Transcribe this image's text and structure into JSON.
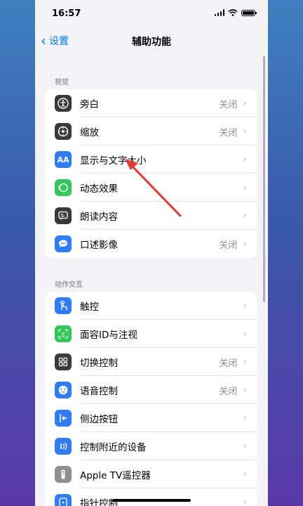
{
  "status": {
    "time": "16:57"
  },
  "navbar": {
    "back_label": "设置",
    "title": "辅助功能"
  },
  "sections": [
    {
      "label": "视觉",
      "items": [
        {
          "label": "旁白",
          "value": "关闭",
          "icon": "voiceover-icon",
          "color": "#3a3a3c"
        },
        {
          "label": "缩放",
          "value": "关闭",
          "icon": "zoom-icon",
          "color": "#3a3a3c"
        },
        {
          "label": "显示与文字大小",
          "value": "",
          "icon": "display-text-size-icon",
          "color": "#2f7cf6"
        },
        {
          "label": "动态效果",
          "value": "",
          "icon": "motion-icon",
          "color": "#34c759"
        },
        {
          "label": "朗读内容",
          "value": "",
          "icon": "spoken-content-icon",
          "color": "#3a3a3c"
        },
        {
          "label": "口述影像",
          "value": "关闭",
          "icon": "audio-description-icon",
          "color": "#2f7cf6"
        }
      ]
    },
    {
      "label": "动作交互",
      "items": [
        {
          "label": "触控",
          "value": "",
          "icon": "touch-icon",
          "color": "#2f7cf6"
        },
        {
          "label": "面容ID与注视",
          "value": "",
          "icon": "face-id-icon",
          "color": "#34c759"
        },
        {
          "label": "切换控制",
          "value": "关闭",
          "icon": "switch-control-icon",
          "color": "#3a3a3c"
        },
        {
          "label": "语音控制",
          "value": "关闭",
          "icon": "voice-control-icon",
          "color": "#2f7cf6"
        },
        {
          "label": "侧边按钮",
          "value": "",
          "icon": "side-button-icon",
          "color": "#2f7cf6"
        },
        {
          "label": "控制附近的设备",
          "value": "",
          "icon": "nearby-devices-icon",
          "color": "#2f7cf6"
        },
        {
          "label": "Apple TV遥控器",
          "value": "",
          "icon": "apple-tv-remote-icon",
          "color": "#8e8e93"
        },
        {
          "label": "指针控制",
          "value": "",
          "icon": "pointer-control-icon",
          "color": "#2f7cf6"
        }
      ]
    }
  ],
  "colors": {
    "accent": "#007aff",
    "annotation_arrow": "#e53935"
  }
}
